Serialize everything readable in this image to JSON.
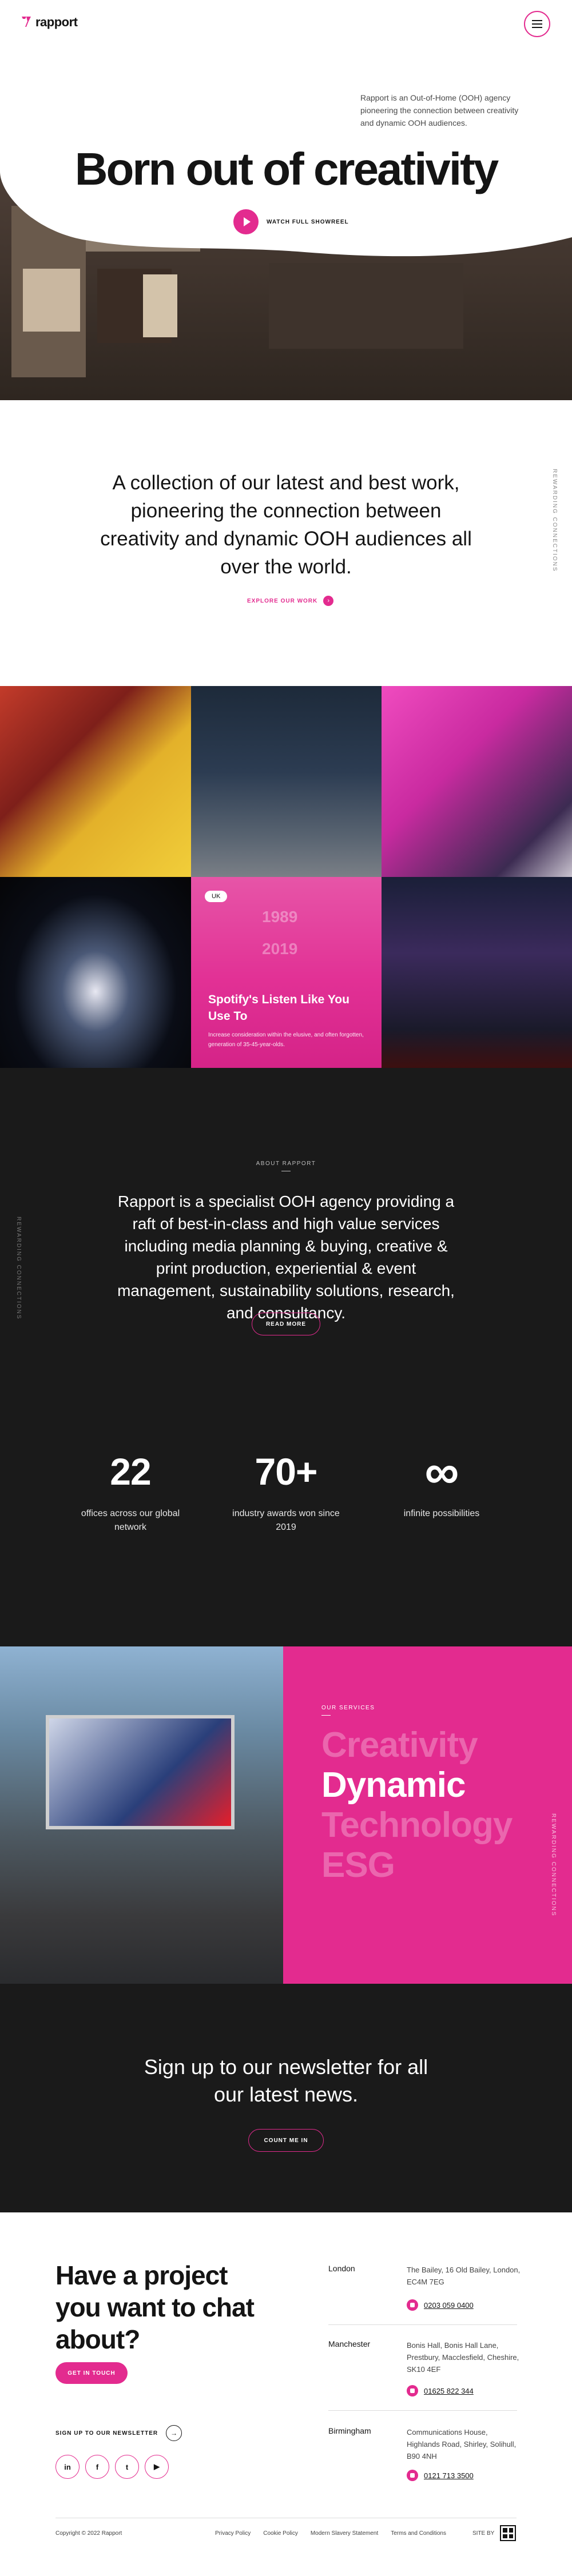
{
  "brand": {
    "name": "rapport",
    "accent": "#e32b8f",
    "dark": "#1a1a1a"
  },
  "header": {
    "menu_icon": "hamburger-icon"
  },
  "hero": {
    "intro": "Rapport is an Out-of-Home (OOH) agency pioneering the connection between creativity and dynamic OOH audiences.",
    "title": "Born out of creativity",
    "showreel_label": "WATCH FULL SHOWREEL",
    "play_icon": "play-icon"
  },
  "intro": {
    "text": "A collection of our latest and best work, pioneering the connection between creativity and dynamic OOH audiences all over the world.",
    "explore_label": "EXPLORE OUR WORK",
    "side_label": "REWARDING CONNECTIONS"
  },
  "work": {
    "featured": {
      "tag": "UK",
      "years": [
        "1989",
        "2019"
      ],
      "title": "Spotify's Listen Like You Use To",
      "description": "Increase consideration within the elusive, and often forgotten, generation of 35-45-year-olds."
    }
  },
  "about": {
    "label": "ABOUT RAPPORT",
    "text": "Rapport is a specialist OOH agency providing a raft of best-in-class and high value services including media planning & buying, creative & print production, experiential & event management, sustainability solutions, research, and consultancy.",
    "read_more": "READ MORE",
    "side_label": "REWARDING CONNECTIONS",
    "stats": [
      {
        "value": "22",
        "label": "offices across our global network"
      },
      {
        "value": "70+",
        "label": "industry awards won since 2019"
      },
      {
        "value": "∞",
        "label": "infinite possibilities"
      }
    ]
  },
  "services": {
    "label": "OUR SERVICES",
    "items": [
      "Creativity",
      "Dynamic",
      "Technology",
      "ESG"
    ],
    "active": "Dynamic",
    "side_label": "REWARDING CONNECTIONS"
  },
  "newsletter": {
    "text": "Sign up to our newsletter for all our latest news.",
    "button": "COUNT ME IN"
  },
  "footer": {
    "cta_title": "Have a project you want to chat about?",
    "cta_button": "GET IN TOUCH",
    "signup_label": "SIGN UP TO OUR NEWSLETTER",
    "socials": [
      {
        "icon": "linkedin-icon",
        "glyph": "in"
      },
      {
        "icon": "facebook-icon",
        "glyph": "f"
      },
      {
        "icon": "twitter-icon",
        "glyph": "t"
      },
      {
        "icon": "youtube-icon",
        "glyph": "▶"
      }
    ],
    "offices": [
      {
        "city": "London",
        "address": "The Bailey, 16 Old Bailey, London, EC4M 7EG",
        "phone": "0203 059 0400"
      },
      {
        "city": "Manchester",
        "address": "Bonis Hall, Bonis Hall Lane, Prestbury, Macclesfield, Cheshire, SK10 4EF",
        "phone": "01625 822 344"
      },
      {
        "city": "Birmingham",
        "address": "Communications House, Highlands Road, Shirley, Solihull, B90 4NH",
        "phone": "0121 713 3500"
      }
    ],
    "copyright": "Copyright © 2022 Rapport",
    "links": [
      "Privacy Policy",
      "Cookie Policy",
      "Modern Slavery Statement",
      "Terms and Conditions"
    ],
    "site_by": "SITE BY"
  }
}
